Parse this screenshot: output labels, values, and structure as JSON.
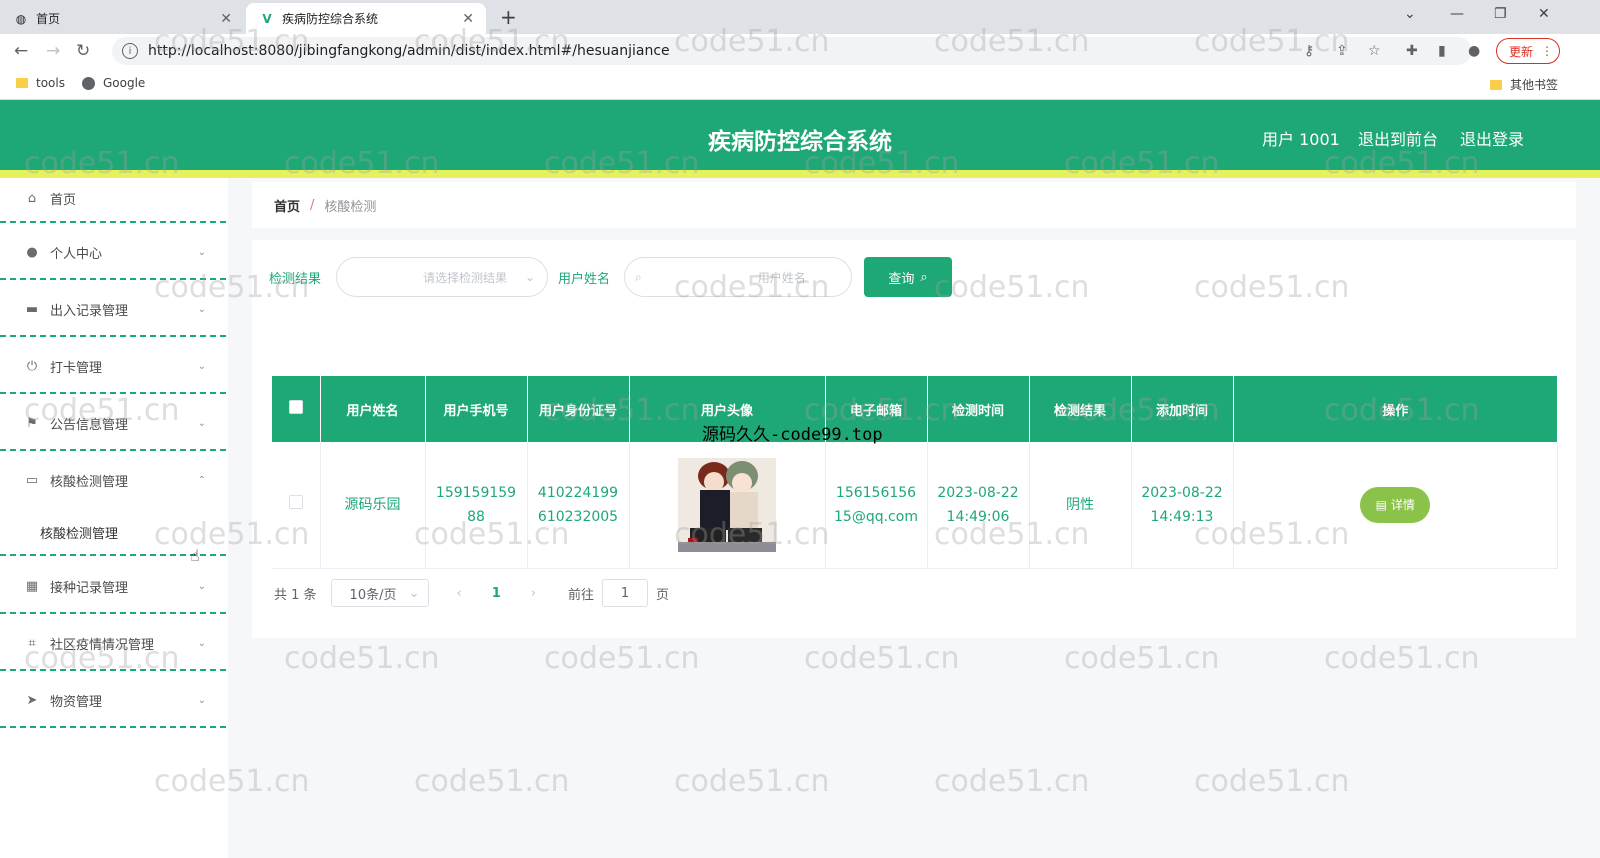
{
  "browser": {
    "tabs": [
      {
        "title": "首页"
      },
      {
        "title": "疾病防控综合系统"
      }
    ],
    "url": "http://localhost:8080/jibingfangkong/admin/dist/index.html#/hesuanjiance",
    "update_label": "更新",
    "bookmarks": [
      "tools",
      "Google"
    ],
    "other_bookmarks": "其他书签"
  },
  "header": {
    "title": "疾病防控综合系统",
    "user": "用户 1001",
    "to_front": "退出到前台",
    "logout": "退出登录",
    "accent_color": "#1ea876"
  },
  "sidebar": {
    "items": [
      {
        "label": "首页",
        "icon": "home-icon"
      },
      {
        "label": "个人中心",
        "icon": "user-icon"
      },
      {
        "label": "出入记录管理",
        "icon": "monitor-icon"
      },
      {
        "label": "打卡管理",
        "icon": "power-icon"
      },
      {
        "label": "公告信息管理",
        "icon": "flag-icon"
      },
      {
        "label": "核酸检测管理",
        "icon": "chat-icon"
      },
      {
        "label": "接种记录管理",
        "icon": "grid-icon"
      },
      {
        "label": "社区疫情情况管理",
        "icon": "crop-icon"
      },
      {
        "label": "物资管理",
        "icon": "send-icon"
      }
    ],
    "sub_item": "核酸检测管理"
  },
  "breadcrumb": {
    "home": "首页",
    "sep": "/",
    "current": "核酸检测"
  },
  "search": {
    "result_label": "检测结果",
    "result_placeholder": "请选择检测结果",
    "name_label": "用户姓名",
    "name_placeholder": "用户姓名",
    "query_label": "查询"
  },
  "table": {
    "columns": [
      "用户姓名",
      "用户手机号",
      "用户身份证号",
      "用户头像",
      "电子邮箱",
      "检测时间",
      "检测结果",
      "添加时间",
      "操作"
    ],
    "rows": [
      {
        "name": "源码乐园",
        "phone": "15915915988",
        "id_card": "410224199610232005",
        "email": "15615615615@qq.com",
        "test_time": "2023-08-22 14:49:06",
        "result": "阴性",
        "add_time": "2023-08-22 14:49:13",
        "action": "详情"
      }
    ]
  },
  "pager": {
    "total": "共 1 条",
    "page_size": "10条/页",
    "current_page": "1",
    "goto_label": "前往",
    "goto_value": "1",
    "page_unit": "页"
  },
  "overlay_text": "源码久久-code99.top",
  "watermark": "code51.cn"
}
